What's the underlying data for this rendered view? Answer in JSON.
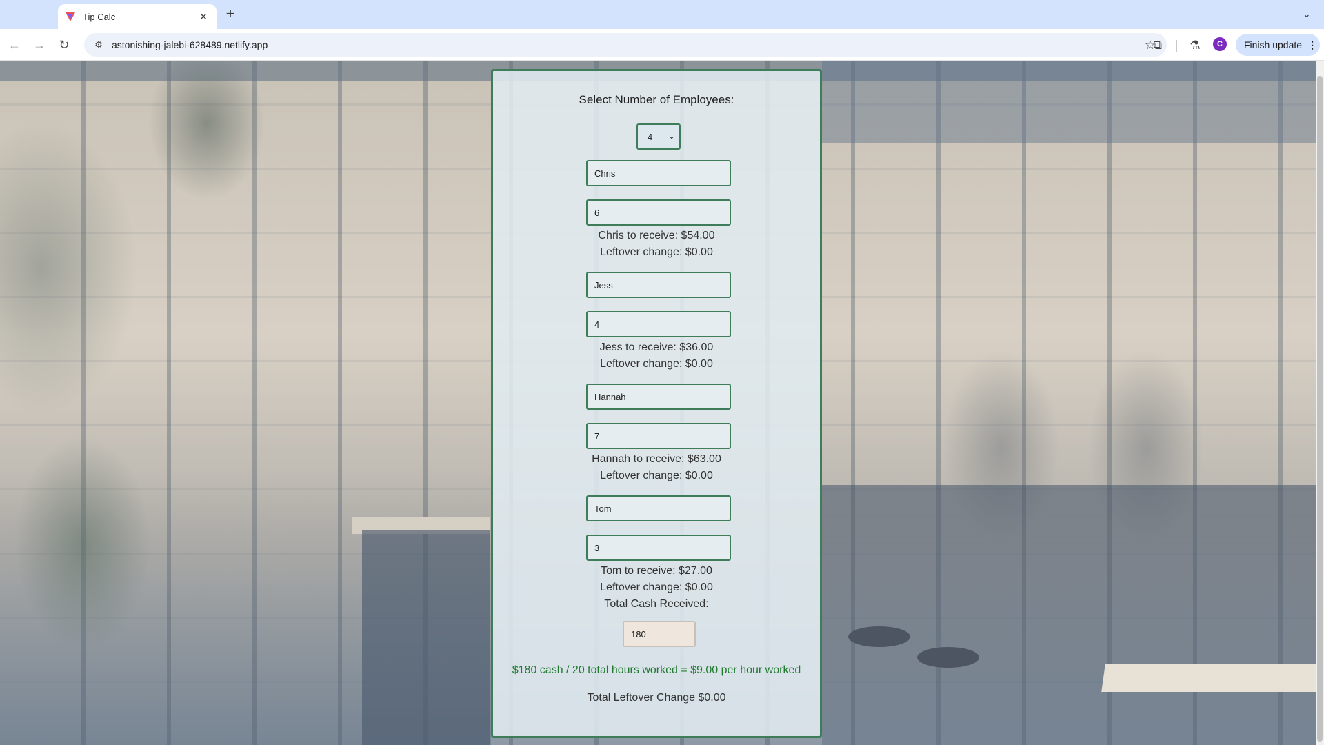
{
  "browser": {
    "tab_title": "Tip Calc",
    "url": "astonishing-jalebi-628489.netlify.app",
    "avatar_letter": "C",
    "update_label": "Finish update"
  },
  "calculator": {
    "heading": "Select Number of Employees:",
    "employee_count": "4",
    "employees": [
      {
        "name": "Chris",
        "hours": "6",
        "receive_text": "Chris to receive: $54.00",
        "leftover_text": "Leftover change: $0.00"
      },
      {
        "name": "Jess",
        "hours": "4",
        "receive_text": "Jess to receive: $36.00",
        "leftover_text": "Leftover change: $0.00"
      },
      {
        "name": "Hannah",
        "hours": "7",
        "receive_text": "Hannah to receive: $63.00",
        "leftover_text": "Leftover change: $0.00"
      },
      {
        "name": "Tom",
        "hours": "3",
        "receive_text": "Tom to receive: $27.00",
        "leftover_text": "Leftover change: $0.00"
      }
    ],
    "cash_label": "Total Cash Received:",
    "cash_value": "180",
    "summary": "$180 cash / 20 total hours worked = $9.00 per hour worked",
    "total_leftover": "Total Leftover Change $0.00"
  },
  "colors": {
    "panel_border": "#3f7d5a",
    "summary_text": "#1f7a2e",
    "tabbar": "#d3e3fd"
  }
}
